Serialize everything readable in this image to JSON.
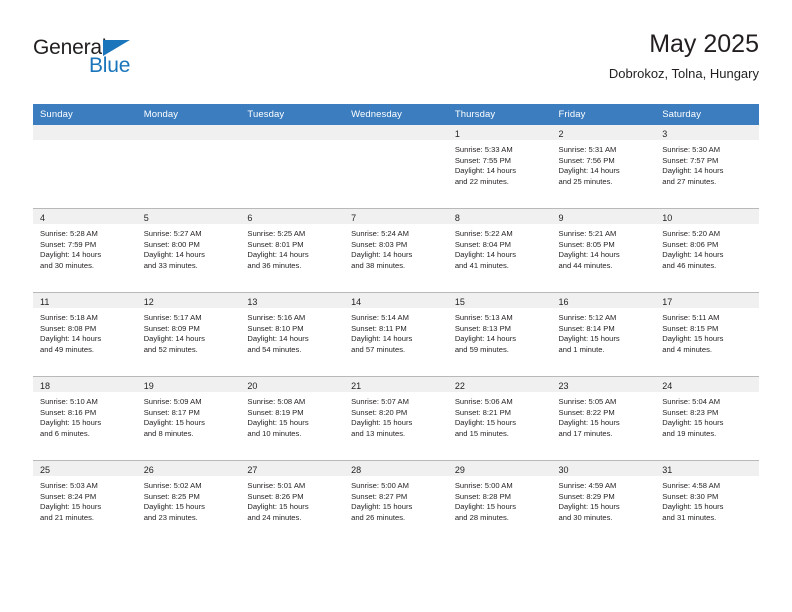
{
  "brand": {
    "name_part1": "General",
    "name_part2": "Blue",
    "triangle_color": "#1b75bb"
  },
  "header": {
    "title": "May 2025",
    "subtitle": "Dobrokoz, Tolna, Hungary"
  },
  "theme": {
    "header_bg": "#3b7dbf",
    "header_text": "#ffffff",
    "daynum_band_bg": "#f0f0f0",
    "text": "#231f20",
    "grid_line": "#b9b9b9"
  },
  "weekdays": [
    "Sunday",
    "Monday",
    "Tuesday",
    "Wednesday",
    "Thursday",
    "Friday",
    "Saturday"
  ],
  "weeks": [
    [
      {
        "day": "",
        "empty": true
      },
      {
        "day": "",
        "empty": true
      },
      {
        "day": "",
        "empty": true
      },
      {
        "day": "",
        "empty": true
      },
      {
        "day": "1",
        "sunrise": "Sunrise: 5:33 AM",
        "sunset": "Sunset: 7:55 PM",
        "daylight1": "Daylight: 14 hours",
        "daylight2": "and 22 minutes."
      },
      {
        "day": "2",
        "sunrise": "Sunrise: 5:31 AM",
        "sunset": "Sunset: 7:56 PM",
        "daylight1": "Daylight: 14 hours",
        "daylight2": "and 25 minutes."
      },
      {
        "day": "3",
        "sunrise": "Sunrise: 5:30 AM",
        "sunset": "Sunset: 7:57 PM",
        "daylight1": "Daylight: 14 hours",
        "daylight2": "and 27 minutes."
      }
    ],
    [
      {
        "day": "4",
        "sunrise": "Sunrise: 5:28 AM",
        "sunset": "Sunset: 7:59 PM",
        "daylight1": "Daylight: 14 hours",
        "daylight2": "and 30 minutes."
      },
      {
        "day": "5",
        "sunrise": "Sunrise: 5:27 AM",
        "sunset": "Sunset: 8:00 PM",
        "daylight1": "Daylight: 14 hours",
        "daylight2": "and 33 minutes."
      },
      {
        "day": "6",
        "sunrise": "Sunrise: 5:25 AM",
        "sunset": "Sunset: 8:01 PM",
        "daylight1": "Daylight: 14 hours",
        "daylight2": "and 36 minutes."
      },
      {
        "day": "7",
        "sunrise": "Sunrise: 5:24 AM",
        "sunset": "Sunset: 8:03 PM",
        "daylight1": "Daylight: 14 hours",
        "daylight2": "and 38 minutes."
      },
      {
        "day": "8",
        "sunrise": "Sunrise: 5:22 AM",
        "sunset": "Sunset: 8:04 PM",
        "daylight1": "Daylight: 14 hours",
        "daylight2": "and 41 minutes."
      },
      {
        "day": "9",
        "sunrise": "Sunrise: 5:21 AM",
        "sunset": "Sunset: 8:05 PM",
        "daylight1": "Daylight: 14 hours",
        "daylight2": "and 44 minutes."
      },
      {
        "day": "10",
        "sunrise": "Sunrise: 5:20 AM",
        "sunset": "Sunset: 8:06 PM",
        "daylight1": "Daylight: 14 hours",
        "daylight2": "and 46 minutes."
      }
    ],
    [
      {
        "day": "11",
        "sunrise": "Sunrise: 5:18 AM",
        "sunset": "Sunset: 8:08 PM",
        "daylight1": "Daylight: 14 hours",
        "daylight2": "and 49 minutes."
      },
      {
        "day": "12",
        "sunrise": "Sunrise: 5:17 AM",
        "sunset": "Sunset: 8:09 PM",
        "daylight1": "Daylight: 14 hours",
        "daylight2": "and 52 minutes."
      },
      {
        "day": "13",
        "sunrise": "Sunrise: 5:16 AM",
        "sunset": "Sunset: 8:10 PM",
        "daylight1": "Daylight: 14 hours",
        "daylight2": "and 54 minutes."
      },
      {
        "day": "14",
        "sunrise": "Sunrise: 5:14 AM",
        "sunset": "Sunset: 8:11 PM",
        "daylight1": "Daylight: 14 hours",
        "daylight2": "and 57 minutes."
      },
      {
        "day": "15",
        "sunrise": "Sunrise: 5:13 AM",
        "sunset": "Sunset: 8:13 PM",
        "daylight1": "Daylight: 14 hours",
        "daylight2": "and 59 minutes."
      },
      {
        "day": "16",
        "sunrise": "Sunrise: 5:12 AM",
        "sunset": "Sunset: 8:14 PM",
        "daylight1": "Daylight: 15 hours",
        "daylight2": "and 1 minute."
      },
      {
        "day": "17",
        "sunrise": "Sunrise: 5:11 AM",
        "sunset": "Sunset: 8:15 PM",
        "daylight1": "Daylight: 15 hours",
        "daylight2": "and 4 minutes."
      }
    ],
    [
      {
        "day": "18",
        "sunrise": "Sunrise: 5:10 AM",
        "sunset": "Sunset: 8:16 PM",
        "daylight1": "Daylight: 15 hours",
        "daylight2": "and 6 minutes."
      },
      {
        "day": "19",
        "sunrise": "Sunrise: 5:09 AM",
        "sunset": "Sunset: 8:17 PM",
        "daylight1": "Daylight: 15 hours",
        "daylight2": "and 8 minutes."
      },
      {
        "day": "20",
        "sunrise": "Sunrise: 5:08 AM",
        "sunset": "Sunset: 8:19 PM",
        "daylight1": "Daylight: 15 hours",
        "daylight2": "and 10 minutes."
      },
      {
        "day": "21",
        "sunrise": "Sunrise: 5:07 AM",
        "sunset": "Sunset: 8:20 PM",
        "daylight1": "Daylight: 15 hours",
        "daylight2": "and 13 minutes."
      },
      {
        "day": "22",
        "sunrise": "Sunrise: 5:06 AM",
        "sunset": "Sunset: 8:21 PM",
        "daylight1": "Daylight: 15 hours",
        "daylight2": "and 15 minutes."
      },
      {
        "day": "23",
        "sunrise": "Sunrise: 5:05 AM",
        "sunset": "Sunset: 8:22 PM",
        "daylight1": "Daylight: 15 hours",
        "daylight2": "and 17 minutes."
      },
      {
        "day": "24",
        "sunrise": "Sunrise: 5:04 AM",
        "sunset": "Sunset: 8:23 PM",
        "daylight1": "Daylight: 15 hours",
        "daylight2": "and 19 minutes."
      }
    ],
    [
      {
        "day": "25",
        "sunrise": "Sunrise: 5:03 AM",
        "sunset": "Sunset: 8:24 PM",
        "daylight1": "Daylight: 15 hours",
        "daylight2": "and 21 minutes."
      },
      {
        "day": "26",
        "sunrise": "Sunrise: 5:02 AM",
        "sunset": "Sunset: 8:25 PM",
        "daylight1": "Daylight: 15 hours",
        "daylight2": "and 23 minutes."
      },
      {
        "day": "27",
        "sunrise": "Sunrise: 5:01 AM",
        "sunset": "Sunset: 8:26 PM",
        "daylight1": "Daylight: 15 hours",
        "daylight2": "and 24 minutes."
      },
      {
        "day": "28",
        "sunrise": "Sunrise: 5:00 AM",
        "sunset": "Sunset: 8:27 PM",
        "daylight1": "Daylight: 15 hours",
        "daylight2": "and 26 minutes."
      },
      {
        "day": "29",
        "sunrise": "Sunrise: 5:00 AM",
        "sunset": "Sunset: 8:28 PM",
        "daylight1": "Daylight: 15 hours",
        "daylight2": "and 28 minutes."
      },
      {
        "day": "30",
        "sunrise": "Sunrise: 4:59 AM",
        "sunset": "Sunset: 8:29 PM",
        "daylight1": "Daylight: 15 hours",
        "daylight2": "and 30 minutes."
      },
      {
        "day": "31",
        "sunrise": "Sunrise: 4:58 AM",
        "sunset": "Sunset: 8:30 PM",
        "daylight1": "Daylight: 15 hours",
        "daylight2": "and 31 minutes."
      }
    ]
  ]
}
